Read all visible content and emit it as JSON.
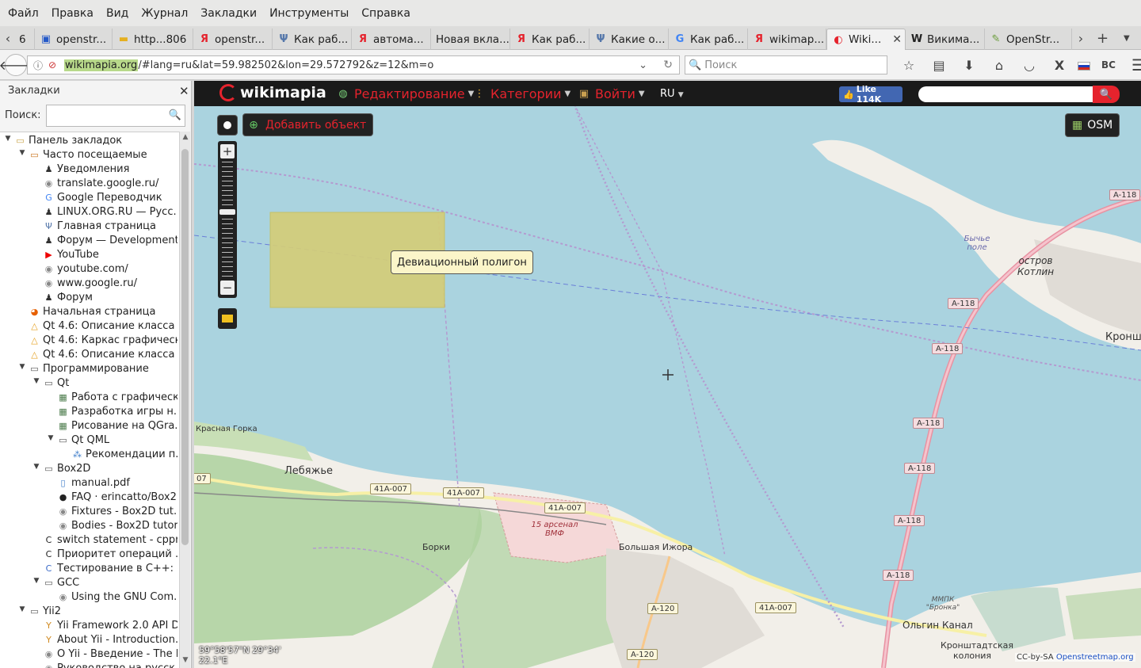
{
  "menubar": [
    "Файл",
    "Правка",
    "Вид",
    "Журнал",
    "Закладки",
    "Инструменты",
    "Справка"
  ],
  "tabs": [
    {
      "label": "6",
      "icon": "",
      "color": "#444"
    },
    {
      "label": "openstr...",
      "icon": "page-icon",
      "color": "#2459c8"
    },
    {
      "label": "http...806",
      "icon": "folder-icon",
      "color": "#e5b020"
    },
    {
      "label": "openstr...",
      "icon": "yandex-icon",
      "color": "#e5232d"
    },
    {
      "label": "Как раб...",
      "icon": "antenna-icon",
      "color": "#5577aa"
    },
    {
      "label": "автома...",
      "icon": "yandex-icon",
      "color": "#e5232d"
    },
    {
      "label": "Новая вкла...",
      "icon": "",
      "color": "#444"
    },
    {
      "label": "Как раб...",
      "icon": "yandex-icon",
      "color": "#e5232d"
    },
    {
      "label": "Какие о...",
      "icon": "antenna-icon",
      "color": "#5577aa"
    },
    {
      "label": "Как раб...",
      "icon": "google-icon",
      "color": "#4285f4"
    },
    {
      "label": "wikimap...",
      "icon": "yandex-icon",
      "color": "#e5232d"
    },
    {
      "label": "Wiki...",
      "icon": "wikimapia-icon",
      "color": "#e5232d"
    },
    {
      "label": "Викима...",
      "icon": "wikipedia-icon",
      "color": "#222"
    },
    {
      "label": "OpenStr...",
      "icon": "osm-icon",
      "color": "#6a9c3a"
    }
  ],
  "nav": {
    "url_host": "wikimapia.org",
    "url_rest": "/#lang=ru&lat=59.982502&lon=29.572792&z=12&m=o",
    "search_placeholder": "Поиск"
  },
  "sidebar": {
    "title": "Закладки",
    "search_label": "Поиск:",
    "tree": [
      {
        "level": 0,
        "label": "Панель закладок",
        "icon": "toolbar-folder-icon",
        "twisty": "open"
      },
      {
        "level": 1,
        "label": "Часто посещаемые",
        "icon": "smart-folder-icon",
        "twisty": "open"
      },
      {
        "level": 2,
        "label": "Уведомления",
        "icon": "tux-icon"
      },
      {
        "level": 2,
        "label": "translate.google.ru/",
        "icon": "globe-icon"
      },
      {
        "level": 2,
        "label": "Google Переводчик",
        "icon": "google-translate-icon"
      },
      {
        "level": 2,
        "label": "LINUX.ORG.RU — Русс...",
        "icon": "tux-icon"
      },
      {
        "level": 2,
        "label": "Главная страница",
        "icon": "antenna-icon"
      },
      {
        "level": 2,
        "label": "Форум — Development",
        "icon": "tux-icon"
      },
      {
        "level": 2,
        "label": "YouTube",
        "icon": "youtube-icon"
      },
      {
        "level": 2,
        "label": "youtube.com/",
        "icon": "globe-icon"
      },
      {
        "level": 2,
        "label": "www.google.ru/",
        "icon": "globe-icon"
      },
      {
        "level": 2,
        "label": "Форум",
        "icon": "tux-icon"
      },
      {
        "level": 1,
        "label": "Начальная страница",
        "icon": "firefox-icon"
      },
      {
        "level": 1,
        "label": "Qt 4.6: Описание класса ...",
        "icon": "qt-icon"
      },
      {
        "level": 1,
        "label": "Qt 4.6: Каркас графическ...",
        "icon": "qt-icon"
      },
      {
        "level": 1,
        "label": "Qt 4.6: Описание класса ...",
        "icon": "qt-icon"
      },
      {
        "level": 1,
        "label": "Программирование",
        "icon": "folder-icon",
        "twisty": "open"
      },
      {
        "level": 2,
        "label": "Qt",
        "icon": "folder-icon",
        "twisty": "open"
      },
      {
        "level": 3,
        "label": "Работа с графическ...",
        "icon": "image-icon"
      },
      {
        "level": 3,
        "label": "Разработка игры н...",
        "icon": "image-icon"
      },
      {
        "level": 3,
        "label": "Рисование на QGra...",
        "icon": "image-icon"
      },
      {
        "level": 3,
        "label": "Qt QML",
        "icon": "folder-icon",
        "twisty": "open"
      },
      {
        "level": 4,
        "label": "Рекомендации п...",
        "icon": "network-icon"
      },
      {
        "level": 2,
        "label": "Box2D",
        "icon": "folder-icon",
        "twisty": "open"
      },
      {
        "level": 3,
        "label": "manual.pdf",
        "icon": "pdf-icon"
      },
      {
        "level": 3,
        "label": "FAQ · erincatto/Box2...",
        "icon": "github-icon"
      },
      {
        "level": 3,
        "label": "Fixtures - Box2D tut...",
        "icon": "globe-icon"
      },
      {
        "level": 3,
        "label": "Bodies - Box2D tutor...",
        "icon": "globe-icon"
      },
      {
        "level": 2,
        "label": "switch statement - cppr...",
        "icon": "cpp-icon"
      },
      {
        "level": 2,
        "label": "Приоритет операций ...",
        "icon": "cpp-icon"
      },
      {
        "level": 2,
        "label": "Тестирование в C++: ст...",
        "icon": "cpp-c-icon"
      },
      {
        "level": 2,
        "label": "GCC",
        "icon": "folder-icon",
        "twisty": "open"
      },
      {
        "level": 3,
        "label": "Using the GNU Com...",
        "icon": "globe-icon"
      },
      {
        "level": 1,
        "label": "Yii2",
        "icon": "folder-icon",
        "twisty": "open"
      },
      {
        "level": 2,
        "label": "Yii Framework 2.0 API D...",
        "icon": "yii-icon"
      },
      {
        "level": 2,
        "label": "About Yii - Introduction...",
        "icon": "yii-icon"
      },
      {
        "level": 2,
        "label": "О Yii - Введение - The D...",
        "icon": "globe-icon"
      },
      {
        "level": 2,
        "label": "Руководство на русск...",
        "icon": "globe-icon"
      }
    ]
  },
  "wikimapia": {
    "logo": "wikimapia",
    "menu_edit": "Редактирование",
    "menu_categories": "Категории",
    "menu_login": "Войти",
    "lang": "RU",
    "fb_like": "Like 114K",
    "add_object": "Добавить объект",
    "layer": "OSM",
    "tooltip": "Девиационный полигон",
    "coords": "59°58'57\"N 29°34'",
    "coords_line2": "22.1\"E",
    "copyright_prefix": "CC-by-SA ",
    "copyright_link": "Openstreetmap.org"
  },
  "map_labels": {
    "red_gorka": "Красная Горка",
    "lebyazhye": "Лебяжье",
    "borki": "Борки",
    "arsenal": "15 арсенал ВМФ",
    "bolshaya_izhora": "Большая Ижора",
    "olgin_kanal": "Ольгин Канал",
    "kronshtadt_koloniya": "Кронштадтская колония",
    "mmpk": "ММПК \"Бронка\"",
    "ostrov_kotlin": "остров Котлин",
    "bychye_pole": "Бычье поле",
    "kronsh": "Кронш"
  },
  "road_badges": [
    {
      "text": "A-118",
      "cls": "red"
    },
    {
      "text": "A-118",
      "cls": "red"
    },
    {
      "text": "A-118",
      "cls": "red"
    },
    {
      "text": "A-118",
      "cls": "red"
    },
    {
      "text": "A-118",
      "cls": "red"
    },
    {
      "text": "A-118",
      "cls": "red"
    },
    {
      "text": "A-118",
      "cls": "red"
    },
    {
      "text": "41A-007",
      "cls": ""
    },
    {
      "text": "41A-007",
      "cls": ""
    },
    {
      "text": "41A-007",
      "cls": ""
    },
    {
      "text": "41A-007",
      "cls": ""
    },
    {
      "text": "A-120",
      "cls": ""
    },
    {
      "text": "A-120",
      "cls": ""
    },
    {
      "text": "07",
      "cls": ""
    }
  ],
  "colors": {
    "water": "#aad3df",
    "land": "#f2efe9",
    "forest": "#add19e",
    "brand_red": "#e5232d",
    "polygon": "#d4cd78"
  }
}
